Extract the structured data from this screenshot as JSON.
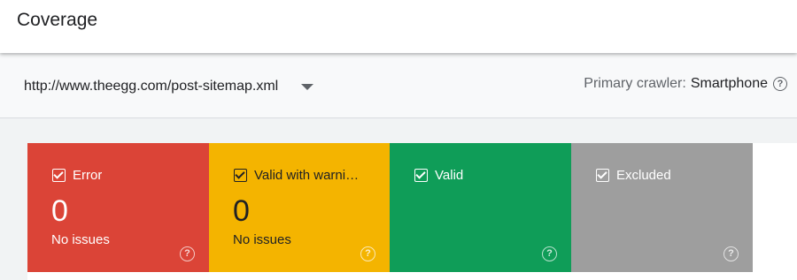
{
  "header": {
    "title": "Coverage"
  },
  "toolbar": {
    "sitemap_value": "http://www.theegg.com/post-sitemap.xml",
    "crawler_label": "Primary crawler:",
    "crawler_value": "Smartphone",
    "help_glyph": "?"
  },
  "colors": {
    "error": "#db4437",
    "warning": "#f4b400",
    "valid": "#0f9d58",
    "excluded": "#9e9e9e"
  },
  "cards": [
    {
      "label": "Error",
      "count": "0",
      "status": "No issues",
      "help_glyph": "?"
    },
    {
      "label": "Valid with warnings",
      "count": "0",
      "status": "No issues",
      "help_glyph": "?"
    },
    {
      "label": "Valid",
      "count": "",
      "status": "",
      "help_glyph": "?"
    },
    {
      "label": "Excluded",
      "count": "",
      "status": "",
      "help_glyph": "?"
    }
  ]
}
